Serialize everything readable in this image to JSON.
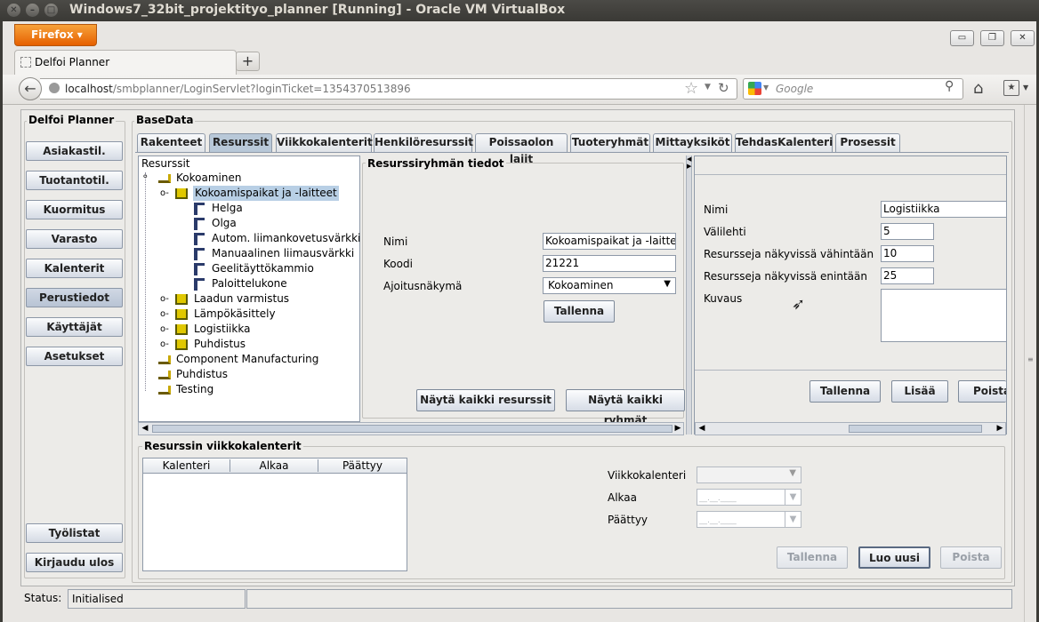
{
  "vbox": {
    "title": "Windows7_32bit_projektityo_planner [Running] - Oracle VM VirtualBox"
  },
  "firefox": {
    "menu_label": "Firefox",
    "tab_title": "Delfoi Planner",
    "url_host": "localhost",
    "url_path": "/smbplanner/LoginServlet?loginTicket=1354370513896",
    "search_placeholder": "Google"
  },
  "sidebar": {
    "title": "Delfoi Planner",
    "items": [
      "Asiakastil.",
      "Tuotantotil.",
      "Kuormitus",
      "Varasto",
      "Kalenterit",
      "Perustiedot",
      "Käyttäjät",
      "Asetukset"
    ],
    "bottom": [
      "Työlistat",
      "Kirjaudu ulos"
    ]
  },
  "main": {
    "title": "BaseData",
    "tabs": [
      "Rakenteet",
      "Resurssit",
      "Viikkokalenterit",
      "Henkilöresurssit",
      "Poissaolon lajit",
      "Tuoteryhmät",
      "Mittayksiköt",
      "TehdasKalenteri",
      "Prosessit"
    ]
  },
  "tree": {
    "root": "Resurssit",
    "items": [
      "Kokoaminen",
      "Kokoamispaikat ja -laitteet",
      "Helga",
      "Olga",
      "Autom. liimankovetusvärkki",
      "Manuaalinen liimausvärkki",
      "Geelitäyttökammio",
      "Paloittelukone",
      "Laadun varmistus",
      "Lämpökäsittely",
      "Logistiikka",
      "Puhdistus",
      "Component Manufacturing",
      "Puhdistus",
      "Testing"
    ]
  },
  "group": {
    "title": "Resurssiryhmän tiedot",
    "labels": [
      "Nimi",
      "Koodi",
      "Ajoitusnäkymä"
    ],
    "values": [
      "Kokoamispaikat ja -laitteet",
      "21221",
      "Kokoaminen"
    ],
    "save": "Tallenna",
    "show_all_resources": "Näytä kaikki resurssit",
    "show_all_groups": "Näytä kaikki ryhmät"
  },
  "detail": {
    "labels": [
      "Nimi",
      "Välilehti",
      "Resursseja näkyvissä vähintään",
      "Resursseja näkyvissä enintään",
      "Kuvaus"
    ],
    "values": [
      "Logistiikka",
      "5",
      "10",
      "25"
    ],
    "save": "Tallenna",
    "add": "Lisää",
    "delete": "Poista"
  },
  "weekcal": {
    "title": "Resurssin viikkokalenterit",
    "columns": [
      "Kalenteri",
      "Alkaa",
      "Päättyy"
    ],
    "labels": [
      "Viikkokalenteri",
      "Alkaa",
      "Päättyy"
    ],
    "date_placeholder": "__.__.____",
    "save": "Tallenna",
    "create": "Luo uusi",
    "delete": "Poista"
  },
  "status": {
    "label": "Status:",
    "value": "Initialised"
  }
}
